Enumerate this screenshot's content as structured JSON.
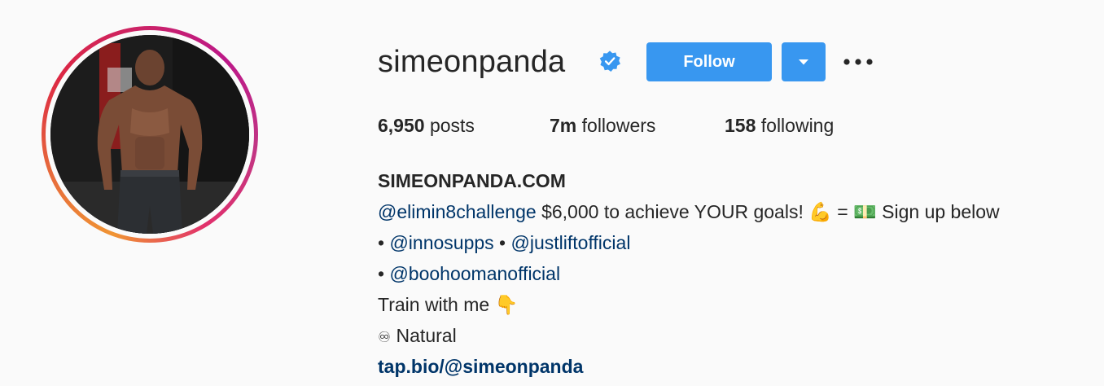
{
  "profile": {
    "username": "simeonpanda",
    "verified": true,
    "follow_label": "Follow",
    "avatar_icon": "profile-photo-bodybuilder"
  },
  "stats": {
    "posts_count": "6,950",
    "posts_label": " posts",
    "followers_count": "7m",
    "followers_label": " followers",
    "following_count": "158",
    "following_label": " following"
  },
  "bio": {
    "full_name": "SIMEONPANDA.COM",
    "line1_mention": "@elimin8challenge",
    "line1_text_a": " $6,000 to achieve YOUR goals! ",
    "line1_emoji_a": "💪",
    "line1_text_b": " = ",
    "line1_emoji_b": "💵",
    "line1_text_c": " Sign up below",
    "line2_bullet_a": "• ",
    "line2_mention_a": "@innosupps",
    "line2_bullet_b": " • ",
    "line2_mention_b": "@justliftofficial",
    "line3_bullet": "• ",
    "line3_mention": "@boohoomanofficial",
    "line4_text": "Train with me ",
    "line4_emoji": "👇",
    "line5_emoji": "♾",
    "line5_text": " Natural",
    "website": "tap.bio/@simeonpanda"
  },
  "colors": {
    "accent": "#3897f0",
    "link": "#003569",
    "text": "#262626",
    "background": "#fafafa"
  }
}
